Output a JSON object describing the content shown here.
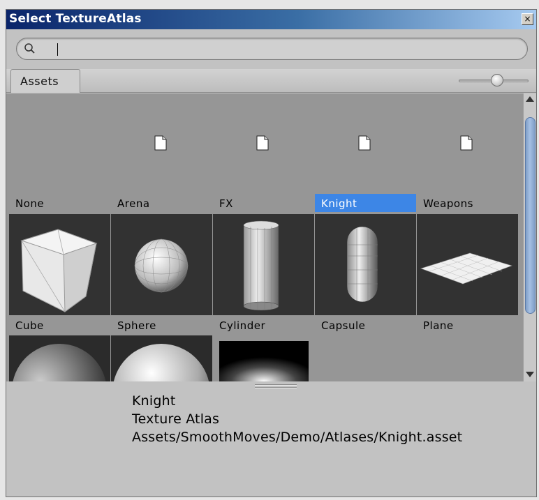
{
  "window": {
    "title": "Select TextureAtlas",
    "close_label": "×"
  },
  "search": {
    "value": "",
    "placeholder": ""
  },
  "tabs": {
    "assets_label": "Assets"
  },
  "row1": [
    {
      "label": "None",
      "icon": "document-icon",
      "selected": false
    },
    {
      "label": "Arena",
      "icon": "document-icon",
      "selected": false
    },
    {
      "label": "FX",
      "icon": "document-icon",
      "selected": false
    },
    {
      "label": "Knight",
      "icon": "document-icon",
      "selected": true
    },
    {
      "label": "Weapons",
      "icon": "document-icon",
      "selected": false
    }
  ],
  "row2": [
    {
      "label": "Cube",
      "preview": "cube-mesh"
    },
    {
      "label": "Sphere",
      "preview": "sphere-mesh"
    },
    {
      "label": "Cylinder",
      "preview": "cylinder-mesh"
    },
    {
      "label": "Capsule",
      "preview": "capsule-mesh"
    },
    {
      "label": "Plane",
      "preview": "plane-mesh"
    }
  ],
  "row3": [
    {
      "preview": "hemisphere-gradient"
    },
    {
      "preview": "sphere-shaded"
    },
    {
      "preview": "radial-glow"
    }
  ],
  "selection_info": {
    "name": "Knight",
    "type": "Texture Atlas",
    "path": "Assets/SmoothMoves/Demo/Atlases/Knight.asset"
  },
  "colors": {
    "selection": "#3d86e6",
    "title_start": "#0a246a",
    "title_end": "#a6caf0"
  }
}
